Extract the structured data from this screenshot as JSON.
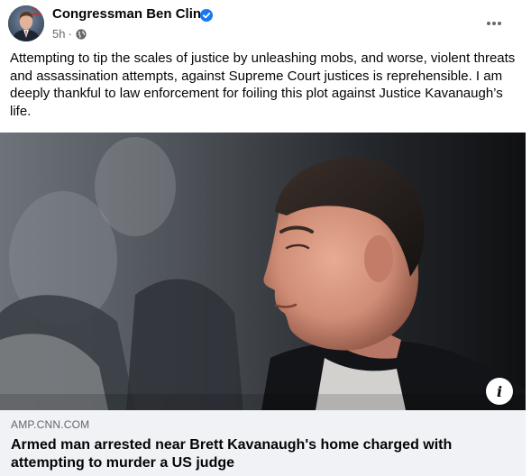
{
  "post": {
    "author": "Congressman Ben Cline",
    "timestamp": "5h",
    "separator": "·",
    "audience_icon": "globe-icon",
    "verified_icon": "verified-badge-icon",
    "more_icon": "more-options-icon",
    "text": "Attempting to tip the scales of justice by unleashing mobs, and worse, violent threats and assassination attempts, against Supreme Court justices is reprehensible. I am deeply thankful to law enforcement for foiling this plot against Justice Kavanaugh’s life."
  },
  "link_preview": {
    "domain": "AMP.CNN.COM",
    "title": "Armed man arrested near Brett Kavanaugh's home charged with attempting to murder a US judge",
    "info_icon": "info-icon"
  },
  "colors": {
    "text_primary": "#050505",
    "text_secondary": "#65676b",
    "verified_blue": "#1877f2",
    "link_meta_bg": "#f0f2f5"
  }
}
